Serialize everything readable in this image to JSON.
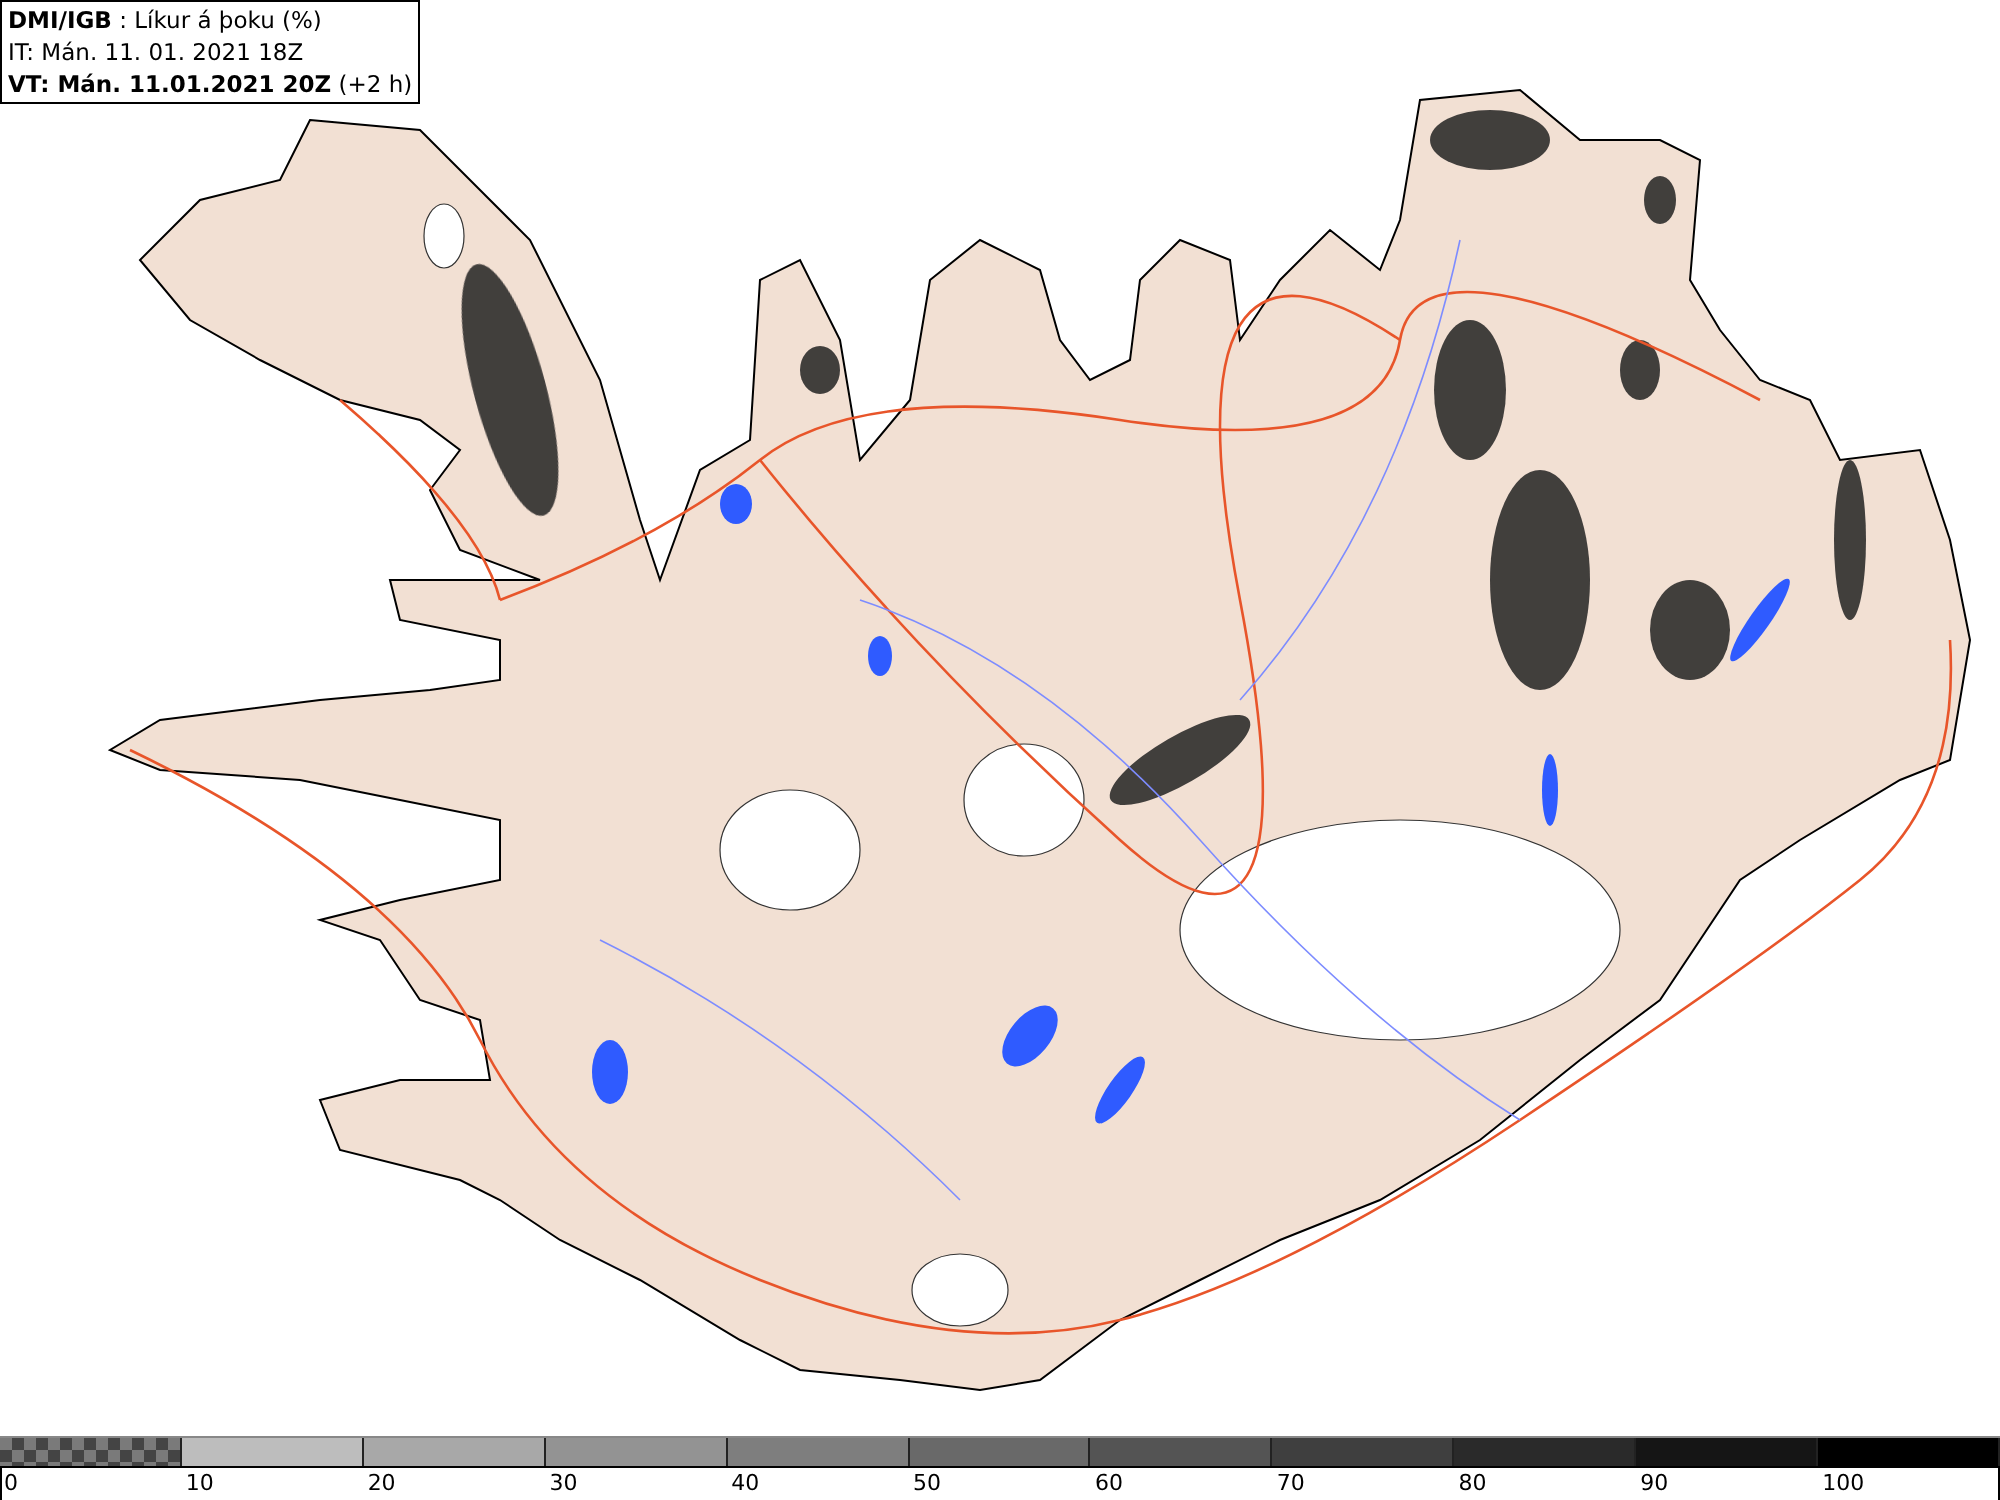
{
  "info_box": {
    "lines": [
      "**DMI/IGB** : Líkur á þoku (%)",
      "IT: Mán. 11. 01. 2021 18Z",
      "**VT: Mán. 11.01.2021 20Z** (+2 h)"
    ]
  },
  "legend": {
    "segments": [
      {
        "kind": "checker",
        "color": "#7a7a7a"
      },
      {
        "kind": "solid",
        "color": "#bdbdbd"
      },
      {
        "kind": "solid",
        "color": "#a8a8a8"
      },
      {
        "kind": "solid",
        "color": "#939393"
      },
      {
        "kind": "solid",
        "color": "#7e7e7e"
      },
      {
        "kind": "solid",
        "color": "#696969"
      },
      {
        "kind": "solid",
        "color": "#545454"
      },
      {
        "kind": "solid",
        "color": "#3f3f3f"
      },
      {
        "kind": "solid",
        "color": "#2a2a2a"
      },
      {
        "kind": "solid",
        "color": "#151515"
      },
      {
        "kind": "solid",
        "color": "#000000"
      }
    ],
    "labels": [
      "0",
      "10",
      "20",
      "30",
      "40",
      "50",
      "60",
      "70",
      "80",
      "90",
      "100"
    ]
  }
}
